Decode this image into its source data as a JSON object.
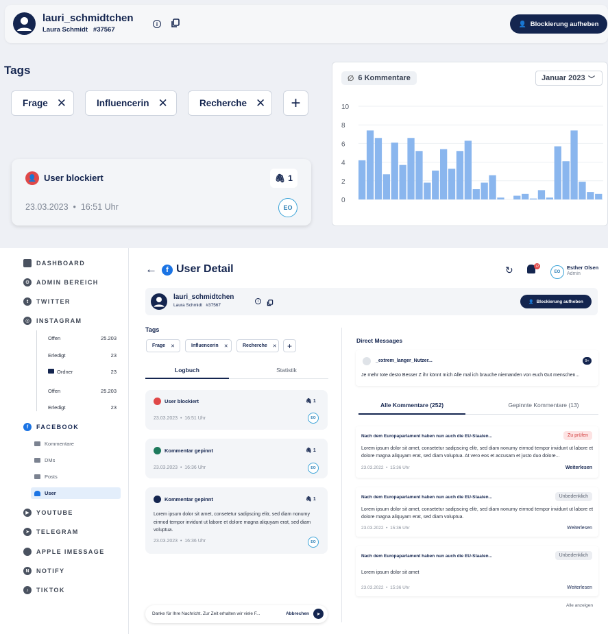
{
  "top_header": {
    "username": "lauri_schmidtchen",
    "realname": "Laura Schmidt",
    "user_id": "#37567",
    "unblock_label": "Blockierung aufheben"
  },
  "tags": {
    "heading": "Tags",
    "items": [
      {
        "label": "Frage"
      },
      {
        "label": "Influencerin"
      },
      {
        "label": "Recherche"
      }
    ]
  },
  "blocked_card": {
    "title": "User blockiert",
    "attachments": "1",
    "date": "23.03.2023",
    "time": "16:51 Uhr",
    "initials": "EO"
  },
  "chart_card": {
    "comment_count": "6 Kommentare",
    "month": "Januar 2023"
  },
  "chart_data": {
    "type": "bar",
    "y_ticks": [
      "10",
      "8",
      "6",
      "4",
      "2",
      "0"
    ],
    "ylim": [
      0,
      10
    ],
    "values": [
      4.2,
      7.4,
      6.6,
      2.7,
      6.1,
      3.7,
      6.6,
      5.2,
      1.8,
      3.1,
      5.4,
      3.3,
      5.2,
      6.3,
      1.1,
      1.8,
      2.6,
      0.2,
      0,
      0.4,
      0.6,
      0.1,
      1.0,
      0.2,
      5.7,
      4.1,
      7.4,
      1.9,
      0.8,
      0.6
    ],
    "grid": true,
    "legend": "none",
    "color": "#8ab6ee"
  },
  "sidebar": {
    "dashboard": "DASHBOARD",
    "admin": "ADMIN BEREICH",
    "twitter": "TWITTER",
    "instagram": "INSTAGRAM",
    "instagram_items": [
      {
        "label": "Offen",
        "count": "25.203"
      },
      {
        "label": "Erledigt",
        "count": "23"
      },
      {
        "label": "Ordner",
        "count": "23"
      },
      {
        "label": "Offen",
        "count": "25.203"
      },
      {
        "label": "Erledigt",
        "count": "23"
      }
    ],
    "facebook": "FACEBOOK",
    "facebook_items": [
      "Kommentare",
      "DMs",
      "Posts",
      "User"
    ],
    "youtube": "YOUTUBE",
    "telegram": "TELEGRAM",
    "imessage": "APPLE IMESSAGE",
    "notify": "NOTIFY",
    "tiktok": "TIKTOK"
  },
  "page": {
    "title": "User Detail",
    "user_name": "Esther Olsen",
    "user_role": "Admin",
    "user_initials": "EO",
    "notif_count": "12"
  },
  "detail_header": {
    "username": "lauri_schmidtchen",
    "realname": "Laura Schmidt",
    "user_id": "#37567",
    "unblock_label": "Blockierung aufheben"
  },
  "detail_tags": {
    "heading": "Tags",
    "items": [
      "Frage",
      "Influencerin",
      "Recherche"
    ]
  },
  "detail_tabs": {
    "logbuch": "Logbuch",
    "statistik": "Statistik"
  },
  "log_entries": [
    {
      "title": "User blockiert",
      "count": "1",
      "date": "23.03.2023",
      "time": "16:51 Uhr",
      "initials": "EO",
      "body": ""
    },
    {
      "title": "Kommentar gepinnt",
      "count": "1",
      "date": "23.03.2023",
      "time": "16:36 Uhr",
      "initials": "EO",
      "body": ""
    },
    {
      "title": "Kommentar gepinnt",
      "count": "1",
      "date": "23.03.2023",
      "time": "16:36 Uhr",
      "initials": "EO",
      "body": "Lorem ipsum dolor sit amet, consetetur sadipscing elitr, sed diam nonumy eirmod tempor invidunt ut labore et dolore magna aliquyam erat, sed diam voluptua."
    }
  ],
  "reply_bar": {
    "text": "Danke für Ihre Nachricht. Zur Zeit erhalten wir viele F...",
    "cancel": "Abbrechen"
  },
  "dm": {
    "heading": "Direct Messages",
    "name": "_extrem_langer_Nutzer...",
    "badge": "9+",
    "text": "Je mehr tote desto Besser Z ihr könnt mich Alle mal ich brauche niemanden von euch Gut menschen..."
  },
  "comment_tabs": {
    "all": "Alle Kommentare (252)",
    "pinned": "Gepinnte Kommentare (13)"
  },
  "comments": [
    {
      "title": "Nach dem Europaparlament haben nun auch die EU-Staaten...",
      "status": "Zu prüfen",
      "body": "Lorem ipsum dolor sit amet, consetetur sadipscing elitr, sed diam nonumy eirmod tempor invidunt ut labore et dolore magna aliquyam erat, sed diam voluptua. At vero eos et accusam et justo duo dolore...",
      "date": "23.03.2022",
      "time": "15:36 Uhr",
      "more": "Weiterlesen"
    },
    {
      "title": "Nach dem Europaparlament haben nun auch die EU-Staaten...",
      "status": "Unbedenklich",
      "body": "Lorem ipsum dolor sit amet, consetetur sadipscing elitr, sed diam nonumy eirmod tempor invidunt ut labore et dolore magna aliquyam erat, sed diam voluptua.",
      "date": "23.03.2022",
      "time": "15:36 Uhr",
      "more": "Weiterlesen"
    },
    {
      "title": "Nach dem Europaparlament haben nun auch die EU-Staaten...",
      "status": "Unbedenklich",
      "body": "Lorem ipsum dolor sit amet",
      "date": "23.03.2022",
      "time": "15:36 Uhr",
      "more": "Weiterlesen"
    }
  ],
  "show_all": "Alle anzeigen",
  "separator": "•",
  "colors": {
    "navy": "#14254f",
    "accent": "#1b74e4",
    "bar": "#8ab6ee",
    "danger": "#e04848"
  }
}
